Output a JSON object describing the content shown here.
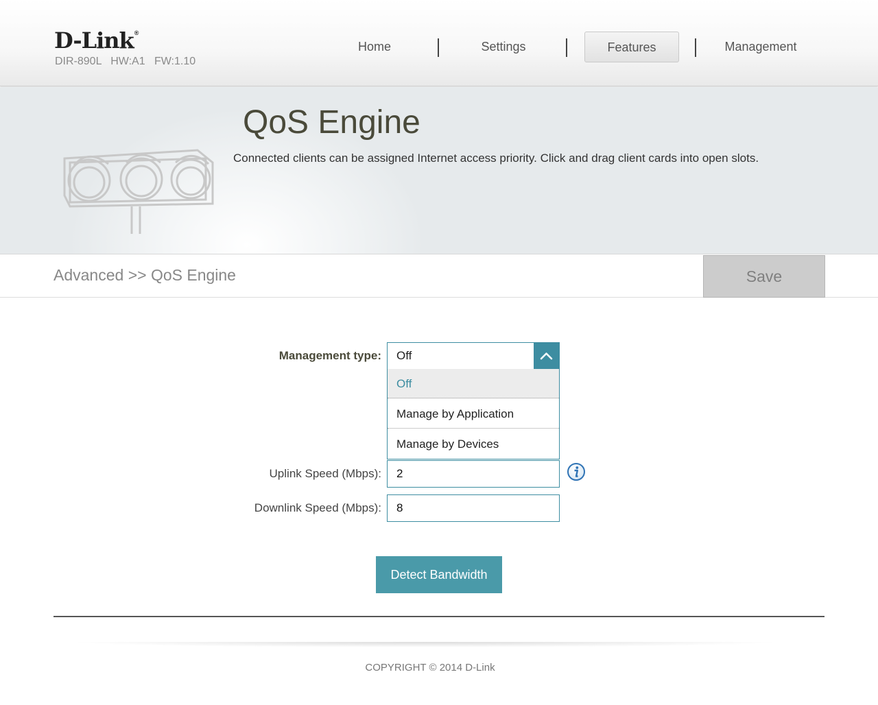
{
  "brand": {
    "logo": "D-Link",
    "registered": "®",
    "model": "DIR-890L",
    "hw": "HW:A1",
    "fw": "FW:1.10"
  },
  "nav": {
    "items": [
      {
        "label": "Home"
      },
      {
        "label": "Settings"
      },
      {
        "label": "Features",
        "active": true
      },
      {
        "label": "Management"
      }
    ]
  },
  "banner": {
    "title": "QoS Engine",
    "description": "Connected clients can be assigned Internet access priority. Click and drag client cards into open slots.",
    "illustration_icon": "traffic-light-icon"
  },
  "breadcrumb": "Advanced >> QoS Engine",
  "save_label": "Save",
  "form": {
    "management_type": {
      "label": "Management type:",
      "value": "Off",
      "expanded": true,
      "options": [
        "Off",
        "Manage by Application",
        "Manage by Devices"
      ],
      "toggle_icon": "chevron-up-icon"
    },
    "uplink": {
      "label": "Uplink Speed (Mbps):",
      "value": "2"
    },
    "downlink": {
      "label": "Downlink Speed (Mbps):",
      "value": "8"
    },
    "info_icon": "info-icon",
    "detect_label": "Detect Bandwidth"
  },
  "footer": {
    "copyright": "COPYRIGHT © 2014 D-Link"
  },
  "colors": {
    "accent": "#3d8da1",
    "button": "#4a9aa9",
    "save_disabled": "#cccccc",
    "title": "#4a4a3a"
  }
}
